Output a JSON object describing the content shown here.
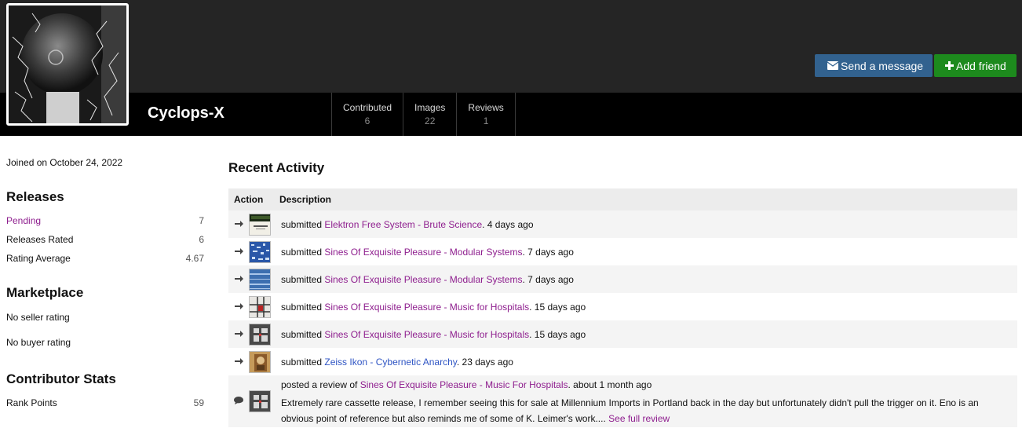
{
  "profile": {
    "username": "Cyclops-X",
    "joined": "Joined on October 24, 2022"
  },
  "stats": [
    {
      "label": "Contributed",
      "value": "6"
    },
    {
      "label": "Images",
      "value": "22"
    },
    {
      "label": "Reviews",
      "value": "1"
    }
  ],
  "actions": {
    "send_message": "Send a message",
    "add_friend": "Add friend",
    "send_message_icon": "envelope-icon",
    "add_friend_icon": "plus-icon"
  },
  "sidebar": {
    "releases": {
      "heading": "Releases",
      "rows": [
        {
          "label": "Pending",
          "value": "7"
        },
        {
          "label": "Releases Rated",
          "value": "6"
        },
        {
          "label": "Rating Average",
          "value": "4.67"
        }
      ]
    },
    "marketplace": {
      "heading": "Marketplace",
      "rows": [
        "No seller rating",
        "No buyer rating"
      ]
    },
    "contributor": {
      "heading": "Contributor Stats",
      "rows": [
        {
          "label": "Rank Points",
          "value": "59"
        }
      ]
    }
  },
  "activity": {
    "heading": "Recent Activity",
    "columns": [
      "Action",
      "Description"
    ],
    "rows": [
      {
        "icon": "arrow-right-icon",
        "verb": "submitted",
        "link": "Elektron Free System - Brute Science",
        "time": ". 4 days ago"
      },
      {
        "icon": "arrow-right-icon",
        "verb": "submitted",
        "link": "Sines Of Exquisite Pleasure - Modular Systems",
        "time": ". 7 days ago"
      },
      {
        "icon": "arrow-right-icon",
        "verb": "submitted",
        "link": "Sines Of Exquisite Pleasure - Modular Systems",
        "time": ". 7 days ago"
      },
      {
        "icon": "arrow-right-icon",
        "verb": "submitted",
        "link": "Sines Of Exquisite Pleasure - Music for Hospitals",
        "time": ". 15 days ago"
      },
      {
        "icon": "arrow-right-icon",
        "verb": "submitted",
        "link": "Sines Of Exquisite Pleasure - Music for Hospitals",
        "time": ". 15 days ago"
      },
      {
        "icon": "arrow-right-icon",
        "verb": "submitted",
        "link": "Zeiss Ikon - Cybernetic Anarchy",
        "time": ". 23 days ago"
      }
    ],
    "review": {
      "icon": "comment-icon",
      "verb": "posted a review of",
      "link": "Sines Of Exquisite Pleasure - Music For Hospitals",
      "time": ". about 1 month ago",
      "body": "Extremely rare cassette release, I remember seeing this for sale at Millennium Imports in Portland back in the day but unfortunately didn't pull the trigger on it. Eno is an obvious point of reference but also reminds me of some of K. Leimer's work....",
      "more": "See full review"
    }
  }
}
